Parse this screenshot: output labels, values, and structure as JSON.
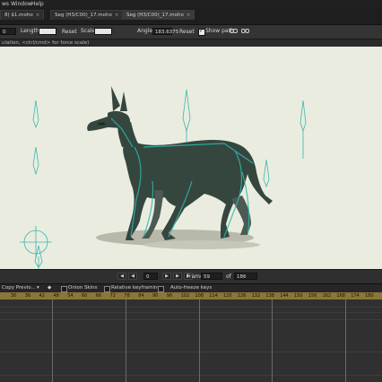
{
  "menu": {
    "items": [
      "ws",
      "Window",
      "Help"
    ]
  },
  "tabs": [
    {
      "label": "8) $1.moho",
      "close": "×"
    },
    {
      "label": "Seg (H3/C00)_17.moho",
      "close": "×"
    },
    {
      "label": "Seg (H3/C00)_17.moho",
      "close": "×"
    }
  ],
  "toolbar": {
    "field0": "0",
    "length_label": "Length",
    "length_value": "",
    "reset1": "Reset",
    "scale_label": "Scale",
    "scale_value": "",
    "angle_label": "Angle",
    "angle_value": "183.6375",
    "reset2": "Reset",
    "show_path_label": "Show path"
  },
  "info_strip": "ulation, <ctrl/cmd> for force scale)",
  "playback": {
    "frame_label": "Frame",
    "frame_value": "59",
    "of_label": "of",
    "total_frames": "186",
    "field_value": "0"
  },
  "timeline": {
    "copy_label": "Copy Previo...",
    "onion_label": "Onion Skins",
    "relative_label": "Relative keyframing",
    "autofreeze_label": "Auto-freeze keys",
    "ruler_numbers": [
      "30",
      "36",
      "42",
      "48",
      "54",
      "60",
      "66",
      "72",
      "78",
      "84",
      "90",
      "96",
      "102",
      "108",
      "114",
      "120",
      "126",
      "132",
      "138",
      "144",
      "150",
      "156",
      "162",
      "168",
      "174",
      "180"
    ]
  }
}
